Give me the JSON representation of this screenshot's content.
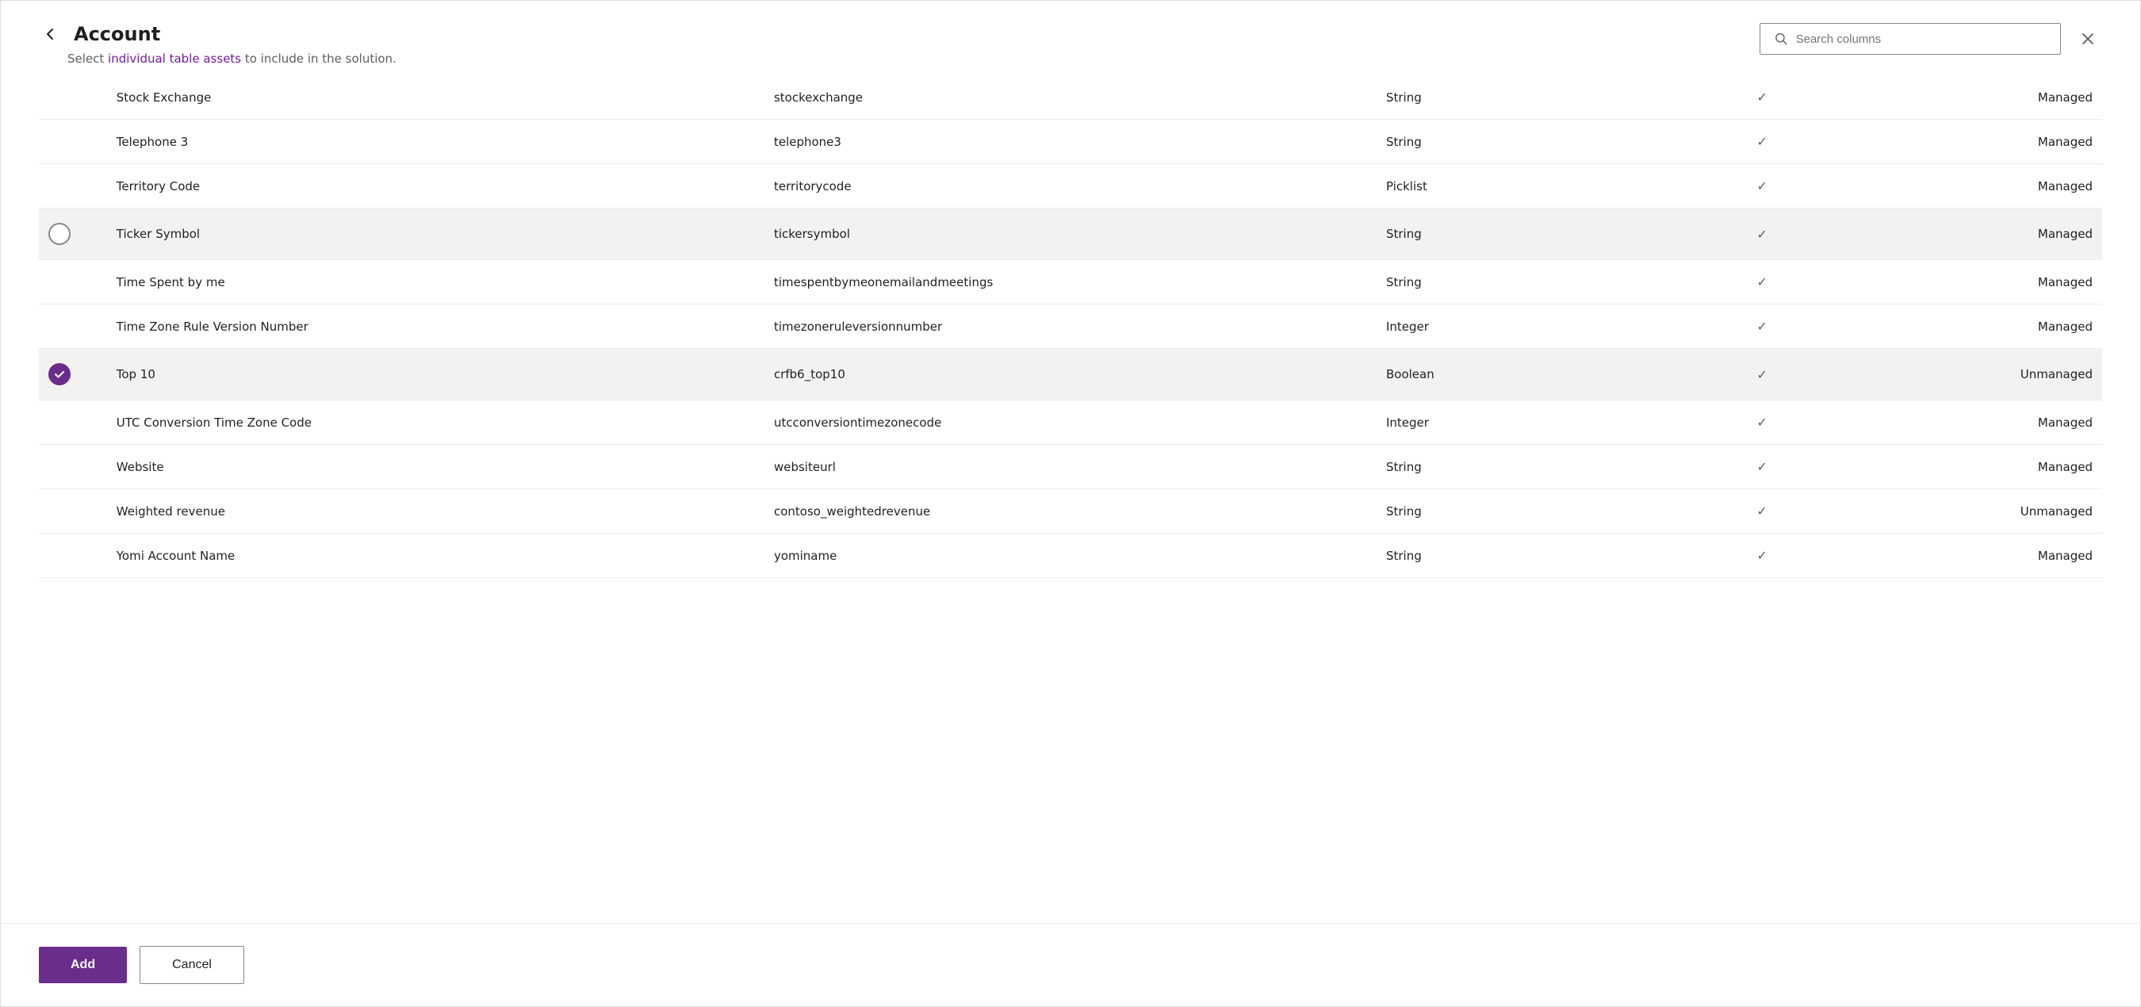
{
  "header": {
    "title": "Account",
    "subtitle_static": "Select ",
    "subtitle_highlight": "individual table assets",
    "subtitle_end": " to include in the solution.",
    "search_placeholder": "Search columns"
  },
  "rows": [
    {
      "id": 1,
      "checked": false,
      "name": "Stock Exchange",
      "schema": "stockexchange",
      "type": "String",
      "has_check": true,
      "managed": "Managed"
    },
    {
      "id": 2,
      "checked": false,
      "name": "Telephone 3",
      "schema": "telephone3",
      "type": "String",
      "has_check": true,
      "managed": "Managed"
    },
    {
      "id": 3,
      "checked": false,
      "name": "Territory Code",
      "schema": "territorycode",
      "type": "Picklist",
      "has_check": true,
      "managed": "Managed"
    },
    {
      "id": 4,
      "checked": false,
      "name": "Ticker Symbol",
      "schema": "tickersymbol",
      "type": "String",
      "has_check": true,
      "managed": "Managed",
      "highlighted": true
    },
    {
      "id": 5,
      "checked": false,
      "name": "Time Spent by me",
      "schema": "timespentbymeonemailandmeetings",
      "type": "String",
      "has_check": true,
      "managed": "Managed"
    },
    {
      "id": 6,
      "checked": false,
      "name": "Time Zone Rule Version Number",
      "schema": "timezoneruleversionnumber",
      "type": "Integer",
      "has_check": true,
      "managed": "Managed"
    },
    {
      "id": 7,
      "checked": true,
      "name": "Top 10",
      "schema": "crfb6_top10",
      "type": "Boolean",
      "has_check": true,
      "managed": "Unmanaged",
      "highlighted": true
    },
    {
      "id": 8,
      "checked": false,
      "name": "UTC Conversion Time Zone Code",
      "schema": "utcconversiontimezonecode",
      "type": "Integer",
      "has_check": true,
      "managed": "Managed"
    },
    {
      "id": 9,
      "checked": false,
      "name": "Website",
      "schema": "websiteurl",
      "type": "String",
      "has_check": true,
      "managed": "Managed"
    },
    {
      "id": 10,
      "checked": false,
      "name": "Weighted revenue",
      "schema": "contoso_weightedrevenue",
      "type": "String",
      "has_check": true,
      "managed": "Unmanaged"
    },
    {
      "id": 11,
      "checked": false,
      "name": "Yomi Account Name",
      "schema": "yominame",
      "type": "String",
      "has_check": true,
      "managed": "Managed"
    }
  ],
  "footer": {
    "add_label": "Add",
    "cancel_label": "Cancel"
  }
}
